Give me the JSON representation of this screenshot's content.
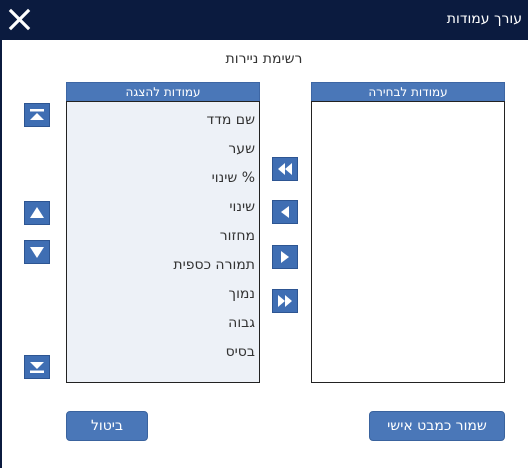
{
  "window": {
    "title": "עורך עמודות",
    "close_icon": "close-icon"
  },
  "dialog": {
    "subtitle": "רשימת ניירות"
  },
  "display_columns": {
    "header": "עמודות להצגה",
    "items": [
      "שם מדד",
      "שער",
      "% שינוי",
      "שינוי",
      "מחזור",
      "תמורה כספית",
      "נמוך",
      "גבוה",
      "בסיס"
    ]
  },
  "available_columns": {
    "header": "עמודות לבחירה",
    "items": []
  },
  "actions": {
    "cancel_label": "ביטול",
    "save_label": "שמור כמבט אישי"
  },
  "colors": {
    "titlebar": "#0b1b3f",
    "accent": "#4a77b8",
    "list_bg": "#edf1f7"
  }
}
